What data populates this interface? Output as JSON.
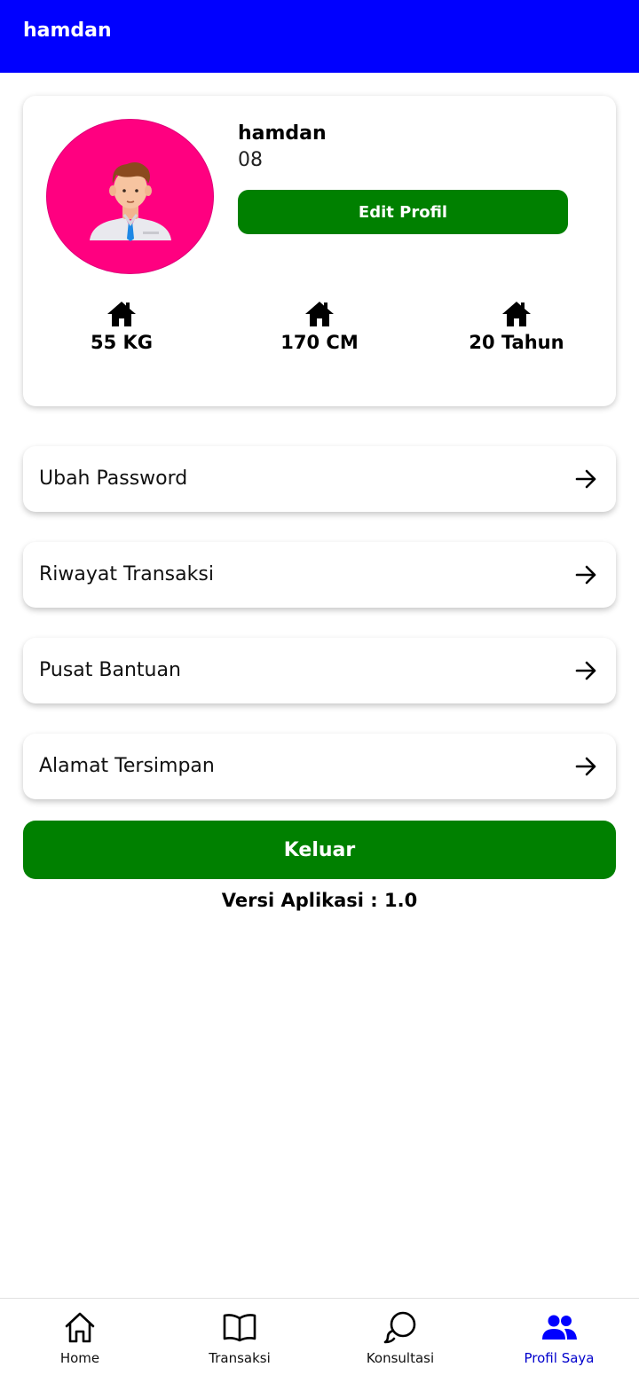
{
  "appbar": {
    "title": "hamdan"
  },
  "profile": {
    "name": "hamdan",
    "phone": "08",
    "edit_label": "Edit Profil",
    "avatar_icon": "person-avatar-icon",
    "avatar_bg": "#ff0080",
    "stats": [
      {
        "icon": "home-icon",
        "label": "55 KG"
      },
      {
        "icon": "home-icon",
        "label": "170 CM"
      },
      {
        "icon": "home-icon",
        "label": "20 Tahun"
      }
    ]
  },
  "menu": [
    {
      "label": "Ubah Password",
      "icon": "arrow-right-icon"
    },
    {
      "label": "Riwayat Transaksi",
      "icon": "arrow-right-icon"
    },
    {
      "label": "Pusat Bantuan",
      "icon": "arrow-right-icon"
    },
    {
      "label": "Alamat Tersimpan",
      "icon": "arrow-right-icon"
    }
  ],
  "logout_label": "Keluar",
  "version_text": "Versi Aplikasi : 1.0",
  "bottom_nav": [
    {
      "label": "Home",
      "icon": "home-outline-icon",
      "active": false
    },
    {
      "label": "Transaksi",
      "icon": "book-icon",
      "active": false
    },
    {
      "label": "Konsultasi",
      "icon": "chat-bubbles-icon",
      "active": false
    },
    {
      "label": "Profil Saya",
      "icon": "people-icon",
      "active": true
    }
  ],
  "colors": {
    "primary": "#0000ff",
    "button_green": "#008000",
    "active_nav": "#0000cc"
  }
}
